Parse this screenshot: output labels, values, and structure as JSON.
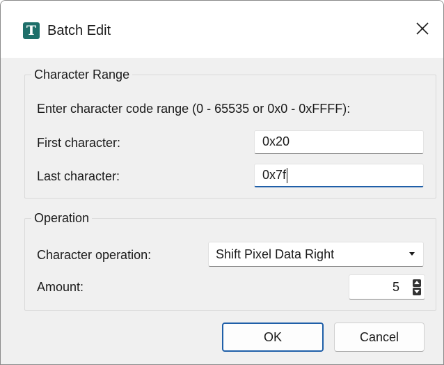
{
  "window": {
    "title": "Batch Edit",
    "icon_letter": "T",
    "close_glyph": "close-icon"
  },
  "character_range": {
    "legend": "Character Range",
    "instructions": "Enter character code range (0 - 65535 or 0x0 - 0xFFFF):",
    "first_label": "First character:",
    "first_value": "0x20",
    "last_label": "Last character:",
    "last_value": "0x7f"
  },
  "operation": {
    "legend": "Operation",
    "operation_label": "Character operation:",
    "operation_selected": "Shift Pixel Data Right",
    "amount_label": "Amount:",
    "amount_value": "5"
  },
  "buttons": {
    "ok": "OK",
    "cancel": "Cancel"
  },
  "colors": {
    "accent": "#1f5fa8",
    "app_icon_bg": "#1e6f6a",
    "dialog_bg": "#f0f0f0"
  }
}
